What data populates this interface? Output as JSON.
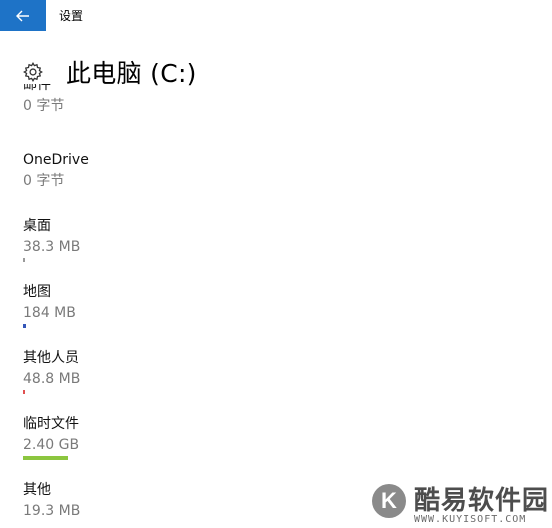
{
  "titlebar": {
    "back_label": "←",
    "app_title": "设置"
  },
  "header": {
    "title": "此电脑 (C:)",
    "icon": "gear-icon"
  },
  "items": [
    {
      "name": "邮件",
      "size": "0 字节",
      "bar_fraction": 0,
      "bar_color": ""
    },
    {
      "name": "OneDrive",
      "size": "0 字节",
      "bar_fraction": 0,
      "bar_color": ""
    },
    {
      "name": "桌面",
      "size": "38.3 MB",
      "bar_fraction": 0.005,
      "bar_color": "#9a9a9a"
    },
    {
      "name": "地图",
      "size": "184 MB",
      "bar_fraction": 0.01,
      "bar_color": "#3456b8"
    },
    {
      "name": "其他人员",
      "size": "48.8 MB",
      "bar_fraction": 0.005,
      "bar_color": "#e05050"
    },
    {
      "name": "临时文件",
      "size": "2.40 GB",
      "bar_fraction": 0.15,
      "bar_color": "#8cc63f"
    },
    {
      "name": "其他",
      "size": "19.3 MB",
      "bar_fraction": 0,
      "bar_color": ""
    }
  ],
  "watermark": {
    "name": "酷易软件园",
    "url": "WWW.KUYISOFT.COM",
    "logo": "K"
  }
}
